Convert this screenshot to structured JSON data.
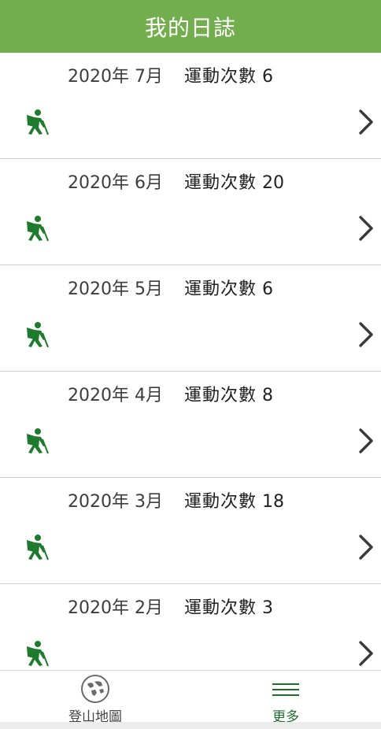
{
  "header": {
    "title": "我的日誌"
  },
  "colors": {
    "header_bg": "#72ad4e",
    "icon_green": "#1e7a2c",
    "active_tab": "#1f6e2e"
  },
  "logs": [
    {
      "date": "2020年 7月",
      "count_label": "運動次數",
      "count": "6",
      "icon": "hiker-icon",
      "chevron": "chevron-right-icon"
    },
    {
      "date": "2020年 6月",
      "count_label": "運動次數",
      "count": "20",
      "icon": "hiker-icon",
      "chevron": "chevron-right-icon"
    },
    {
      "date": "2020年 5月",
      "count_label": "運動次數",
      "count": "6",
      "icon": "hiker-icon",
      "chevron": "chevron-right-icon"
    },
    {
      "date": "2020年 4月",
      "count_label": "運動次數",
      "count": "8",
      "icon": "hiker-icon",
      "chevron": "chevron-right-icon"
    },
    {
      "date": "2020年 3月",
      "count_label": "運動次數",
      "count": "18",
      "icon": "hiker-icon",
      "chevron": "chevron-right-icon"
    },
    {
      "date": "2020年 2月",
      "count_label": "運動次數",
      "count": "3",
      "icon": "hiker-icon",
      "chevron": "chevron-right-icon"
    }
  ],
  "tabbar": {
    "tabs": [
      {
        "label": "登山地圖",
        "icon": "globe-icon",
        "active": false
      },
      {
        "label": "更多",
        "icon": "menu-icon",
        "active": true
      }
    ]
  }
}
